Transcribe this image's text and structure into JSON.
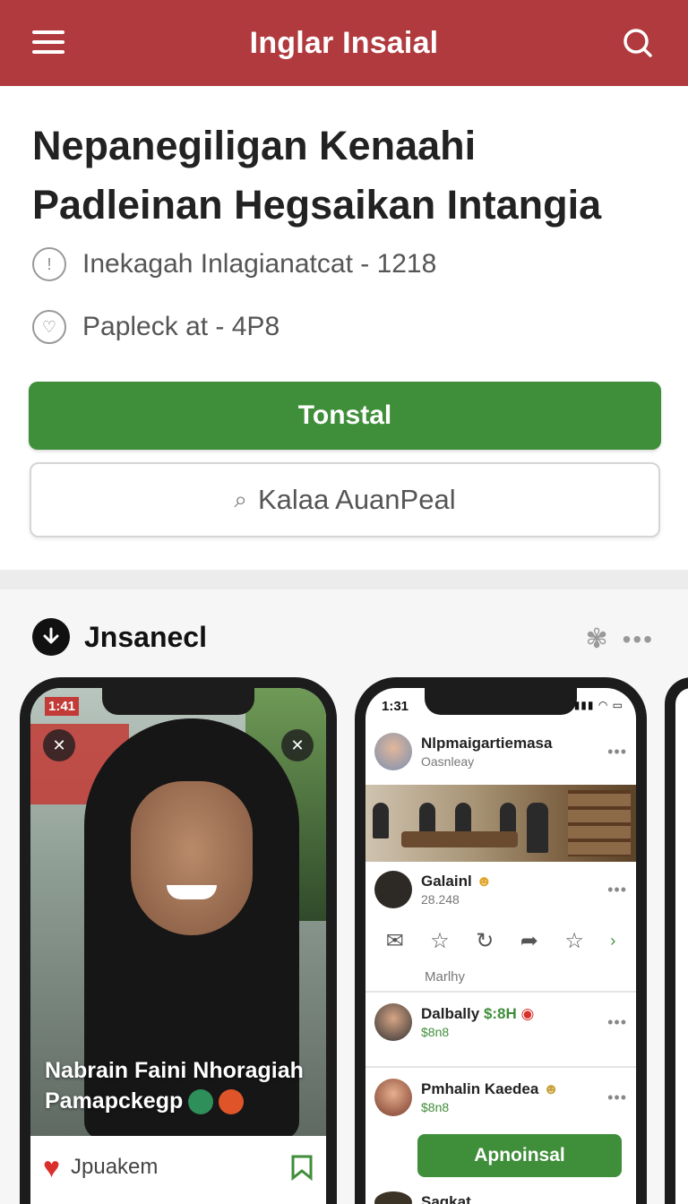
{
  "topbar": {
    "title": "Inglar Insaial",
    "menu_icon": "menu-icon",
    "search_icon": "search-icon",
    "bg": "#b03a3e"
  },
  "hero": {
    "title": "Nepanegiligan Kenaahi Padleinan Hegsaikan Intangia",
    "meta1": {
      "icon": "info-icon",
      "text": "Inekagah Inlagianatcat - 1218"
    },
    "meta2": {
      "icon": "heart-circle-icon",
      "text": "Papleck at - 4P8"
    },
    "primary_button": "Tonstal",
    "secondary_button": "Kalaa AuanPeal",
    "secondary_icon": "search-icon",
    "accent": "#3f8e3a"
  },
  "section": {
    "label": "Jnsanecl",
    "icon": "download-icon"
  },
  "phone1": {
    "time": "1:41",
    "caption_line1": "Nabrain Faini Nhoragiah",
    "caption_line2": "Pamapckegp",
    "bottom_name": "Jpuakem"
  },
  "phone2": {
    "time": "1:31",
    "post1": {
      "name": "Nlpmaigartiemasa",
      "sub": "Oasnleay"
    },
    "post2": {
      "name": "Galainl",
      "sub": "28.248"
    },
    "actions_label": "Marlhy",
    "post3": {
      "name": "Dalbally",
      "tag": "$:8H",
      "sub": "$8n8"
    },
    "post4": {
      "name": "Pmhalin Kaedea",
      "sub": "$8n8"
    },
    "action_button": "Apnoinsal",
    "post5": {
      "name": "Saqkat"
    }
  }
}
